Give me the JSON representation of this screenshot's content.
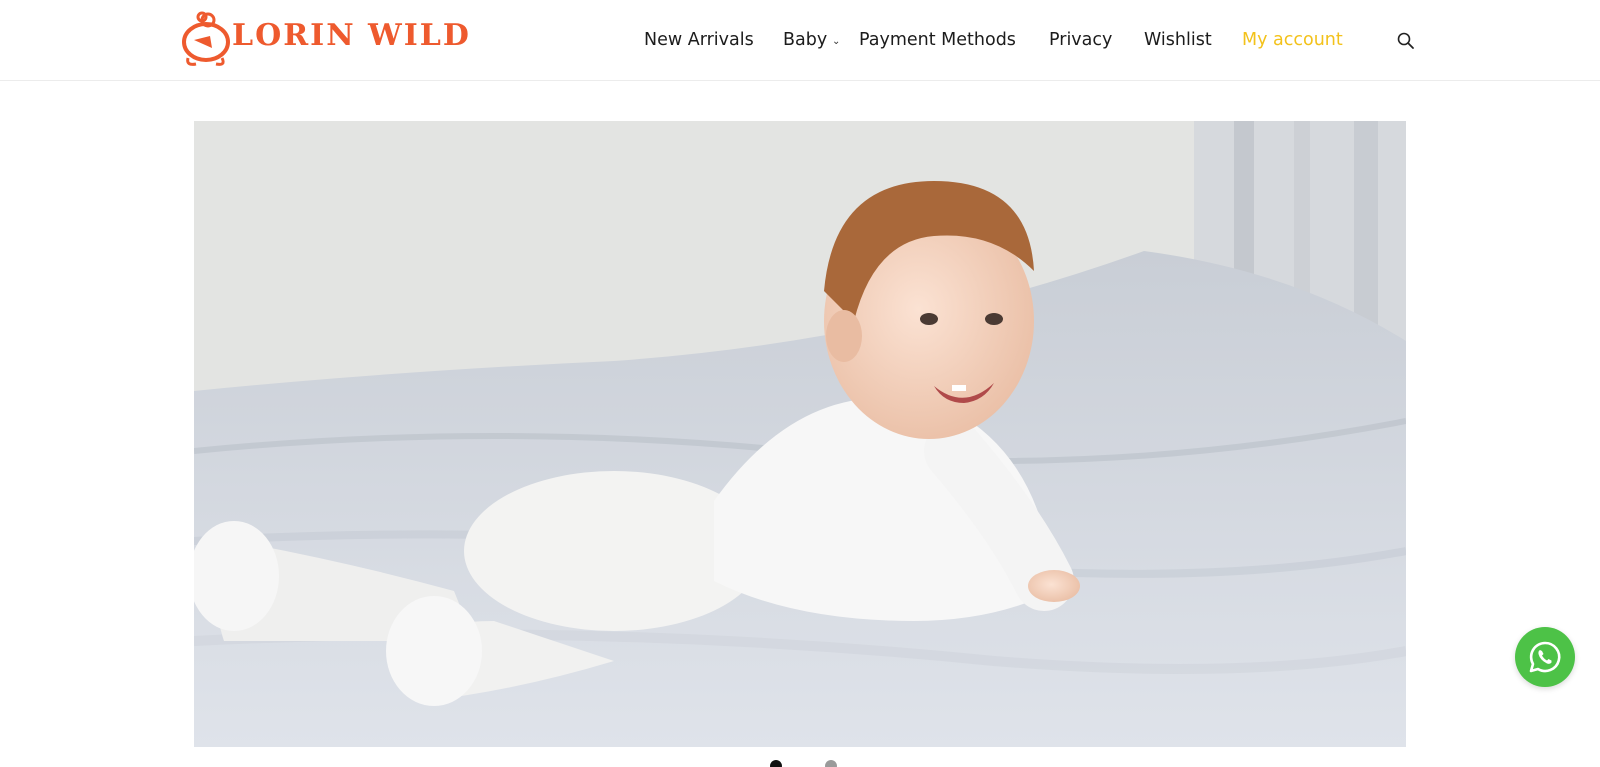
{
  "brand": {
    "name": "Lorin Wild",
    "color": "#ee5a2e"
  },
  "nav": {
    "items": [
      {
        "label": "New Arrivals",
        "active": false
      },
      {
        "label": "Baby",
        "active": false,
        "has_dropdown": true
      },
      {
        "label": "Payment Methods",
        "active": false
      },
      {
        "label": "Privacy",
        "active": false
      },
      {
        "label": "Wishlist",
        "active": false
      },
      {
        "label": "My account",
        "active": true
      }
    ],
    "active_color": "#f3c21b",
    "search_icon": "search-icon",
    "dropdown_icon": "chevron-down-icon"
  },
  "hero": {
    "slide_count": 2,
    "active_slide": 1
  },
  "whatsapp": {
    "icon": "whatsapp-icon",
    "color": "#4dc247"
  }
}
